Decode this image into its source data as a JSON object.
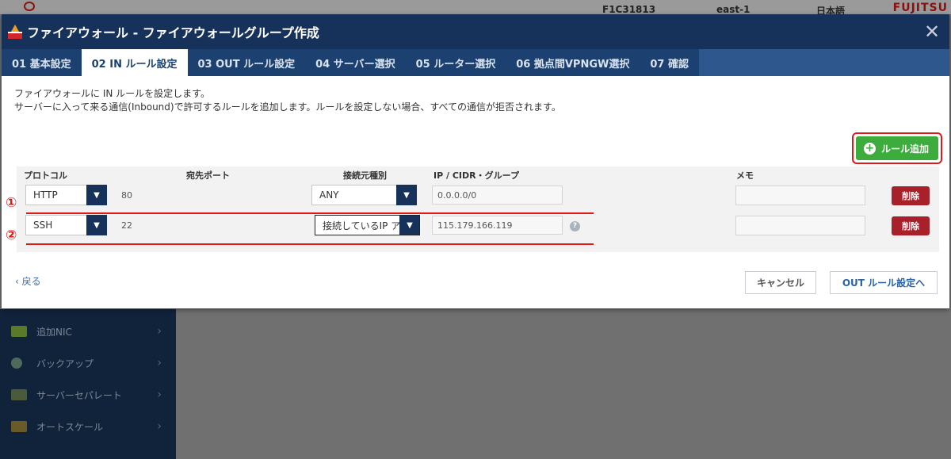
{
  "background": {
    "topbar": {
      "account": "F1C31813",
      "region": "east-1",
      "language": "日本語",
      "logo": "FUJITSU"
    },
    "sidebar_items": [
      {
        "label": "追加NIC",
        "icon": "nic-icon"
      },
      {
        "label": "バックアップ",
        "icon": "backup-icon"
      },
      {
        "label": "サーバーセパレート",
        "icon": "separate-icon"
      },
      {
        "label": "オートスケール",
        "icon": "autoscale-icon"
      }
    ]
  },
  "modal": {
    "title": "ファイアウォール - ファイアウォールグループ作成",
    "close_glyph": "✕",
    "tabs": [
      {
        "label": "01 基本設定",
        "active": false
      },
      {
        "label": "02 IN ルール設定",
        "active": true
      },
      {
        "label": "03 OUT ルール設定",
        "active": false
      },
      {
        "label": "04 サーバー選択",
        "active": false
      },
      {
        "label": "05 ルーター選択",
        "active": false
      },
      {
        "label": "06 拠点間VPNGW選択",
        "active": false
      },
      {
        "label": "07 確認",
        "active": false
      }
    ],
    "description": [
      "ファイアウォールに IN ルールを設定します。",
      "サーバーに入って来る通信(Inbound)で許可するルールを追加します。ルールを設定しない場合、すべての通信が拒否されます。"
    ],
    "add_rule_label": "ルール追加",
    "columns": {
      "protocol": "プロトコル",
      "dest_port": "宛先ポート",
      "source_type": "接続元種別",
      "ip_cidr": "IP / CIDR・グループ",
      "memo": "メモ"
    },
    "rules": [
      {
        "marker": "①",
        "protocol": "HTTP",
        "port": "80",
        "source_type": "ANY",
        "ip": "0.0.0.0/0",
        "memo": "",
        "delete_label": "削除"
      },
      {
        "marker": "②",
        "protocol": "SSH",
        "port": "22",
        "source_type": "接続しているIP ア",
        "ip": "115.179.166.119",
        "memo": "",
        "delete_label": "削除"
      }
    ],
    "back_label": "戻る",
    "cancel_label": "キャンセル",
    "next_label": "OUT ルール設定へ"
  },
  "colors": {
    "header_bg": "#17325a",
    "tabs_bg": "#1c4170",
    "add_button": "#3cac3c",
    "delete_button": "#a8202a",
    "annotation_red": "#e01818"
  }
}
